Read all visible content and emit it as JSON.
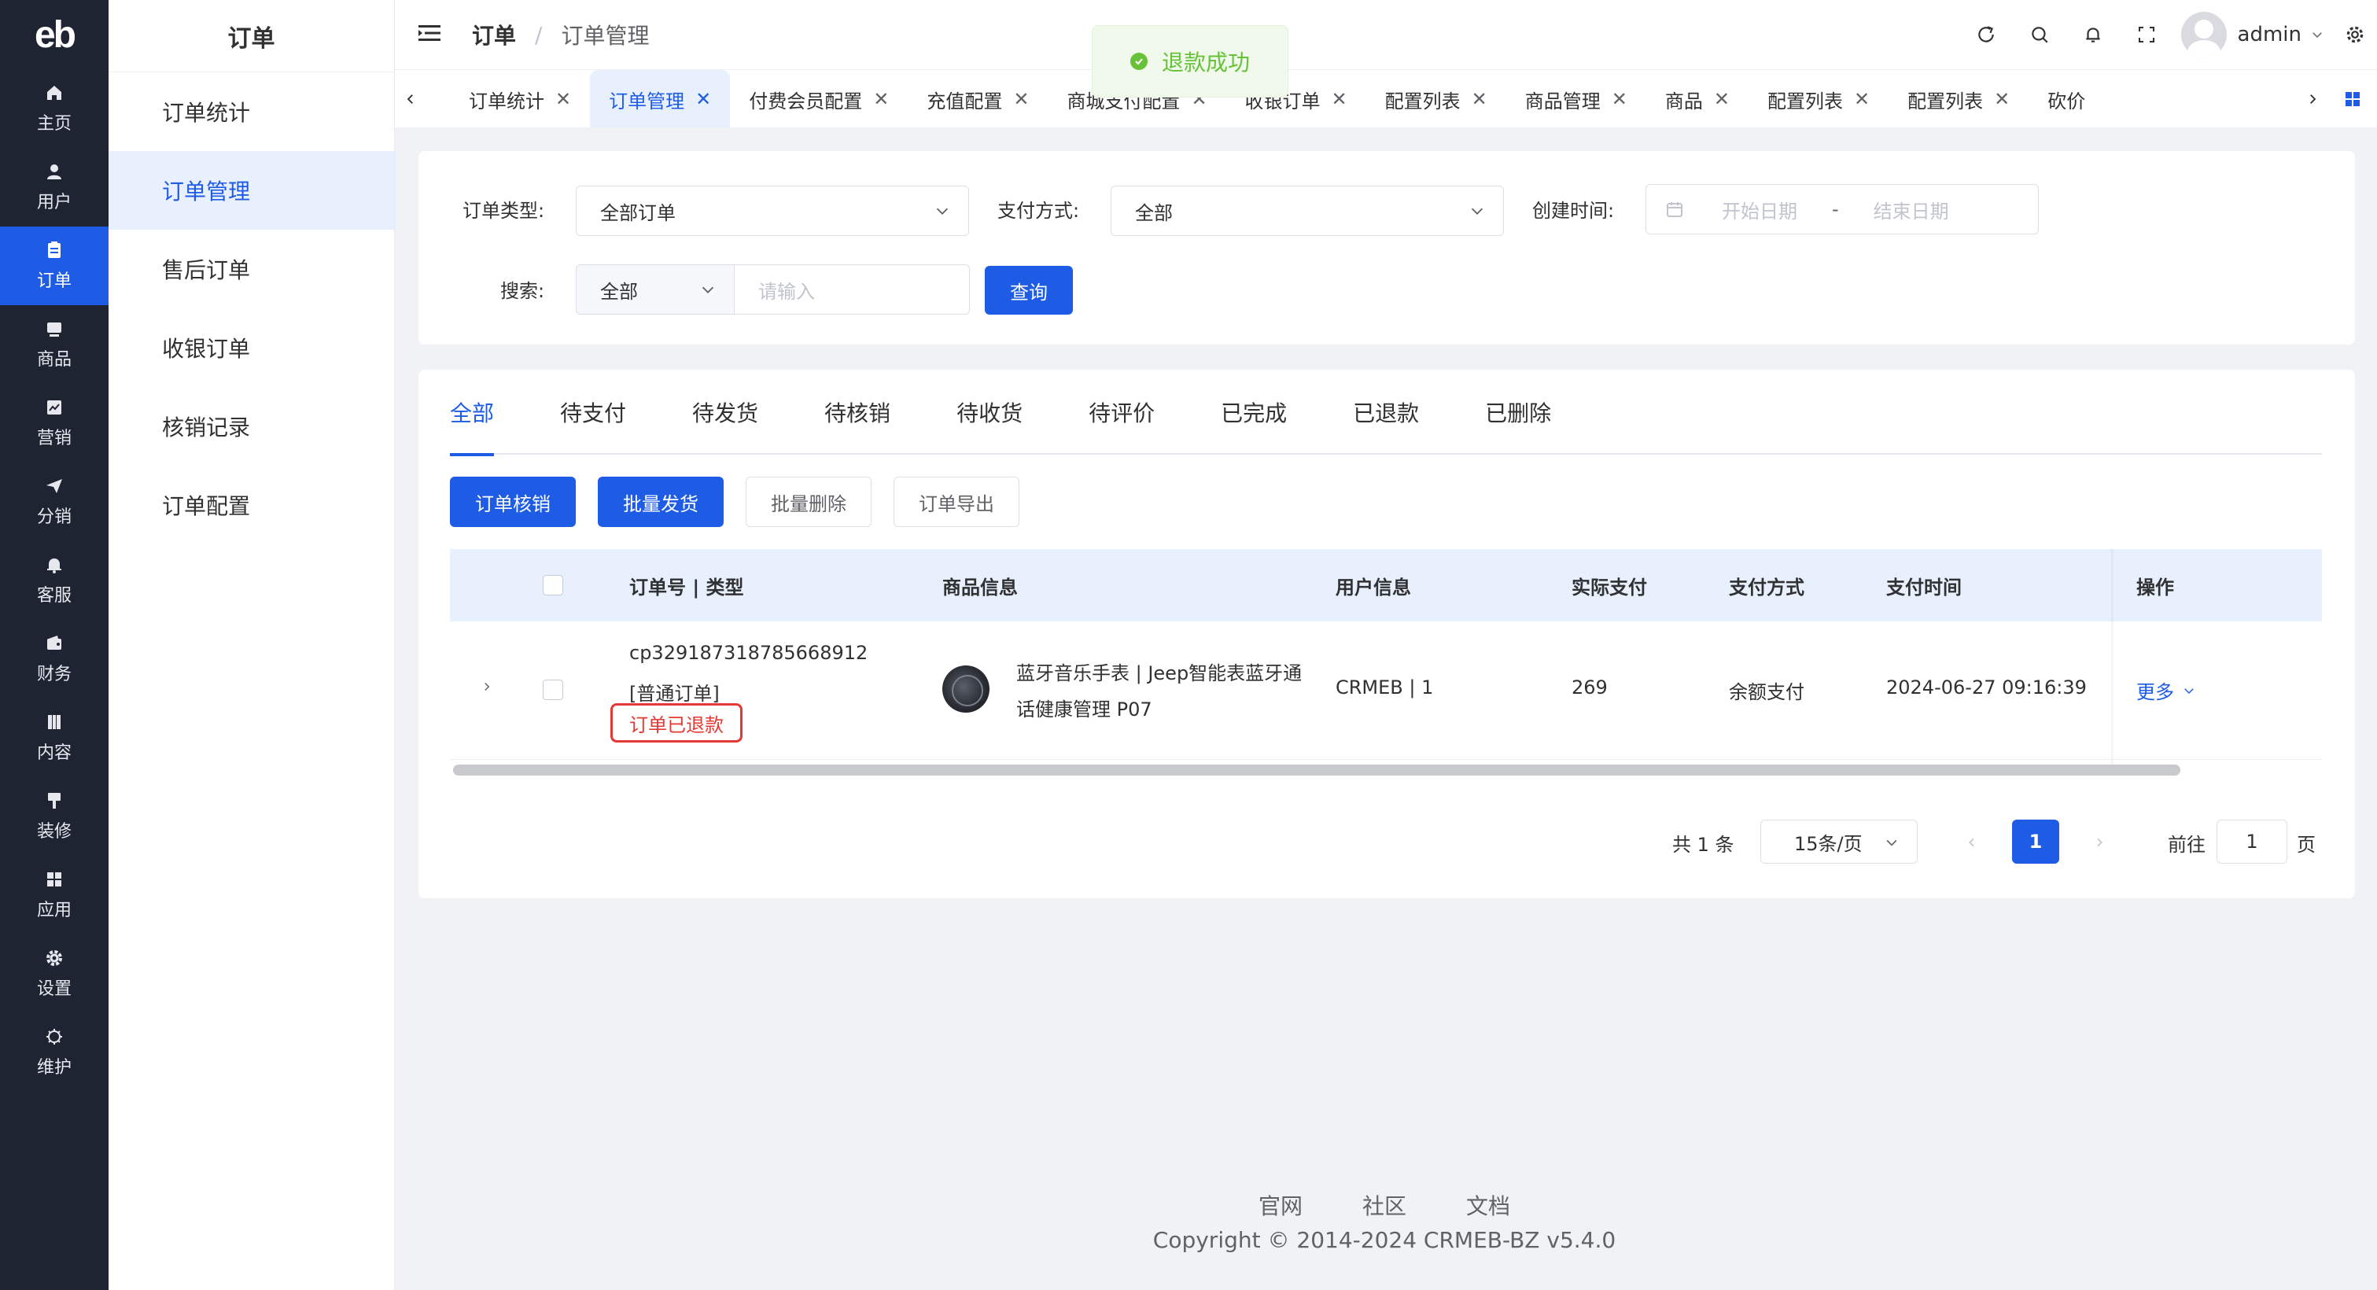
{
  "app": {
    "logo_text": "eb"
  },
  "nav": {
    "items": [
      {
        "label": "主页",
        "icon": "home-icon"
      },
      {
        "label": "用户",
        "icon": "user-icon"
      },
      {
        "label": "订单",
        "icon": "order-icon"
      },
      {
        "label": "商品",
        "icon": "product-icon"
      },
      {
        "label": "营销",
        "icon": "chart-icon"
      },
      {
        "label": "分销",
        "icon": "send-icon"
      },
      {
        "label": "客服",
        "icon": "bell-icon"
      },
      {
        "label": "财务",
        "icon": "wallet-icon"
      },
      {
        "label": "内容",
        "icon": "book-icon"
      },
      {
        "label": "装修",
        "icon": "brush-icon"
      },
      {
        "label": "应用",
        "icon": "grid-icon"
      },
      {
        "label": "设置",
        "icon": "gear-icon"
      },
      {
        "label": "维护",
        "icon": "chip-icon"
      }
    ]
  },
  "submenu": {
    "title": "订单",
    "items": [
      "订单统计",
      "订单管理",
      "售后订单",
      "收银订单",
      "核销记录",
      "订单配置"
    ]
  },
  "header": {
    "breadcrumb_1": "订单",
    "breadcrumb_sep": "/",
    "breadcrumb_2": "订单管理",
    "username": "admin"
  },
  "toast": {
    "text": "退款成功"
  },
  "tags": [
    {
      "label": "订单统计"
    },
    {
      "label": "订单管理"
    },
    {
      "label": "付费会员配置"
    },
    {
      "label": "充值配置"
    },
    {
      "label": "商城支付配置"
    },
    {
      "label": "收银订单"
    },
    {
      "label": "配置列表"
    },
    {
      "label": "商品管理"
    },
    {
      "label": "商品"
    },
    {
      "label": "配置列表"
    },
    {
      "label": "配置列表"
    },
    {
      "label": "砍价"
    }
  ],
  "tag_close": "✕",
  "filters": {
    "order_type_label": "订单类型:",
    "order_type_value": "全部订单",
    "pay_method_label": "支付方式:",
    "pay_method_value": "全部",
    "created_label": "创建时间:",
    "start_placeholder": "开始日期",
    "date_sep": "-",
    "end_placeholder": "结束日期",
    "search_label": "搜索:",
    "search_scope": "全部",
    "search_placeholder": "请输入",
    "query_button": "查询"
  },
  "order_tabs": [
    "全部",
    "待支付",
    "待发货",
    "待核销",
    "待收货",
    "待评价",
    "已完成",
    "已退款",
    "已删除"
  ],
  "actions": {
    "verify": "订单核销",
    "batch_ship": "批量发货",
    "batch_delete": "批量删除",
    "export": "订单导出"
  },
  "table": {
    "headers": {
      "order_no": "订单号 | 类型",
      "goods": "商品信息",
      "user": "用户信息",
      "paid": "实际支付",
      "pay_method": "支付方式",
      "pay_time": "支付时间",
      "ops": "操作"
    },
    "rows": [
      {
        "order_no": "cp329187318785668912",
        "order_type": "[普通订单]",
        "status": "订单已退款",
        "goods_line1": "蓝牙音乐手表 | Jeep智能表蓝牙通",
        "goods_line2": "话健康管理 P07",
        "user": "CRMEB | 1",
        "paid": "269",
        "pay_method": "余额支付",
        "pay_time": "2024-06-27 09:16:39",
        "more": "更多"
      }
    ]
  },
  "pagination": {
    "total": "共 1 条",
    "page_size": "15条/页",
    "current_page": "1",
    "goto_label": "前往",
    "goto_value": "1",
    "page_unit": "页"
  },
  "footer": {
    "links": [
      "官网",
      "社区",
      "文档"
    ],
    "copyright": "Copyright © 2014-2024 CRMEB-BZ v5.4.0"
  },
  "colors": {
    "primary": "#1e5ce6",
    "nav_bg": "#1f2433",
    "refund_red": "#e53935",
    "toast_green": "#67c23a"
  }
}
